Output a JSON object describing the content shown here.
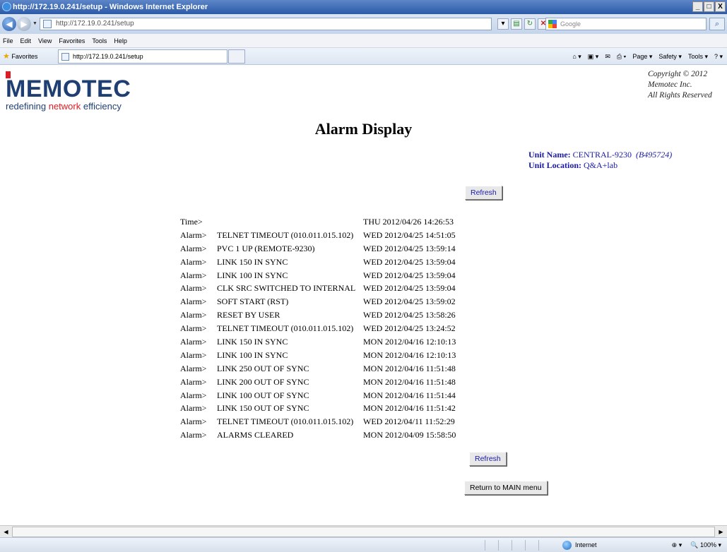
{
  "window": {
    "title": "http://172.19.0.241/setup - Windows Internet Explorer",
    "min": "_",
    "max": "□",
    "close": "X"
  },
  "address": {
    "url": "http://172.19.0.241/setup",
    "search_placeholder": "Google"
  },
  "menu": [
    "File",
    "Edit",
    "View",
    "Favorites",
    "Tools",
    "Help"
  ],
  "favorites": {
    "label": "Favorites",
    "tab_title": "http://172.19.0.241/setup"
  },
  "commands": [
    "Page ▾",
    "Safety ▾",
    "Tools ▾"
  ],
  "logo": {
    "name": "MEMOTEC",
    "tag_prefix": "redefining ",
    "tag_highlight": "network",
    "tag_suffix": " efficiency"
  },
  "copyright": {
    "line1": "Copyright © 2012",
    "line2": "Memotec Inc.",
    "line3": "All Rights Reserved"
  },
  "page": {
    "title": "Alarm Display"
  },
  "unit": {
    "name_label": "Unit Name:",
    "name_value": "CENTRAL-9230",
    "serial": "(B495724)",
    "location_label": "Unit Location:",
    "location_value": "Q&A+lab"
  },
  "buttons": {
    "refresh_top": "Refresh",
    "refresh_bottom": "Refresh",
    "return_main": "Return to MAIN menu"
  },
  "time_row": {
    "label": "Time>",
    "event": "",
    "timestamp": "THU 2012/04/26 14:26:53"
  },
  "alarms": [
    {
      "label": "Alarm>",
      "event": "TELNET TIMEOUT (010.011.015.102)",
      "timestamp": "WED 2012/04/25 14:51:05"
    },
    {
      "label": "Alarm>",
      "event": "PVC 1 UP (REMOTE-9230)",
      "timestamp": "WED 2012/04/25 13:59:14"
    },
    {
      "label": "Alarm>",
      "event": "LINK 150 IN SYNC",
      "timestamp": "WED 2012/04/25 13:59:04"
    },
    {
      "label": "Alarm>",
      "event": "LINK 100 IN SYNC",
      "timestamp": "WED 2012/04/25 13:59:04"
    },
    {
      "label": "Alarm>",
      "event": "CLK SRC SWITCHED TO INTERNAL",
      "timestamp": "WED 2012/04/25 13:59:04"
    },
    {
      "label": "Alarm>",
      "event": "SOFT START (RST)",
      "timestamp": "WED 2012/04/25 13:59:02"
    },
    {
      "label": "Alarm>",
      "event": "RESET BY USER",
      "timestamp": "WED 2012/04/25 13:58:26"
    },
    {
      "label": "Alarm>",
      "event": "TELNET TIMEOUT (010.011.015.102)",
      "timestamp": "WED 2012/04/25 13:24:52"
    },
    {
      "label": "Alarm>",
      "event": "LINK 150 IN SYNC",
      "timestamp": "MON 2012/04/16 12:10:13"
    },
    {
      "label": "Alarm>",
      "event": "LINK 100 IN SYNC",
      "timestamp": "MON 2012/04/16 12:10:13"
    },
    {
      "label": "Alarm>",
      "event": "LINK 250 OUT OF SYNC",
      "timestamp": "MON 2012/04/16 11:51:48"
    },
    {
      "label": "Alarm>",
      "event": "LINK 200 OUT OF SYNC",
      "timestamp": "MON 2012/04/16 11:51:48"
    },
    {
      "label": "Alarm>",
      "event": "LINK 100 OUT OF SYNC",
      "timestamp": "MON 2012/04/16 11:51:44"
    },
    {
      "label": "Alarm>",
      "event": "LINK 150 OUT OF SYNC",
      "timestamp": "MON 2012/04/16 11:51:42"
    },
    {
      "label": "Alarm>",
      "event": "TELNET TIMEOUT (010.011.015.102)",
      "timestamp": "WED 2012/04/11 11:52:29"
    },
    {
      "label": "Alarm>",
      "event": "ALARMS CLEARED",
      "timestamp": "MON 2012/04/09 15:58:50"
    }
  ],
  "status": {
    "zone": "Internet",
    "zoom": "100%"
  },
  "icons": {
    "back": "back-arrow-icon",
    "forward": "forward-arrow-icon",
    "refresh": "refresh-icon",
    "stop": "stop-icon",
    "home": "home-icon",
    "feeds": "feeds-icon",
    "print": "print-icon",
    "help": "help-icon",
    "globe": "globe-icon"
  },
  "colors": {
    "brand": "#1f3f73",
    "accent": "#e01b22",
    "link": "#1a1aa6"
  }
}
